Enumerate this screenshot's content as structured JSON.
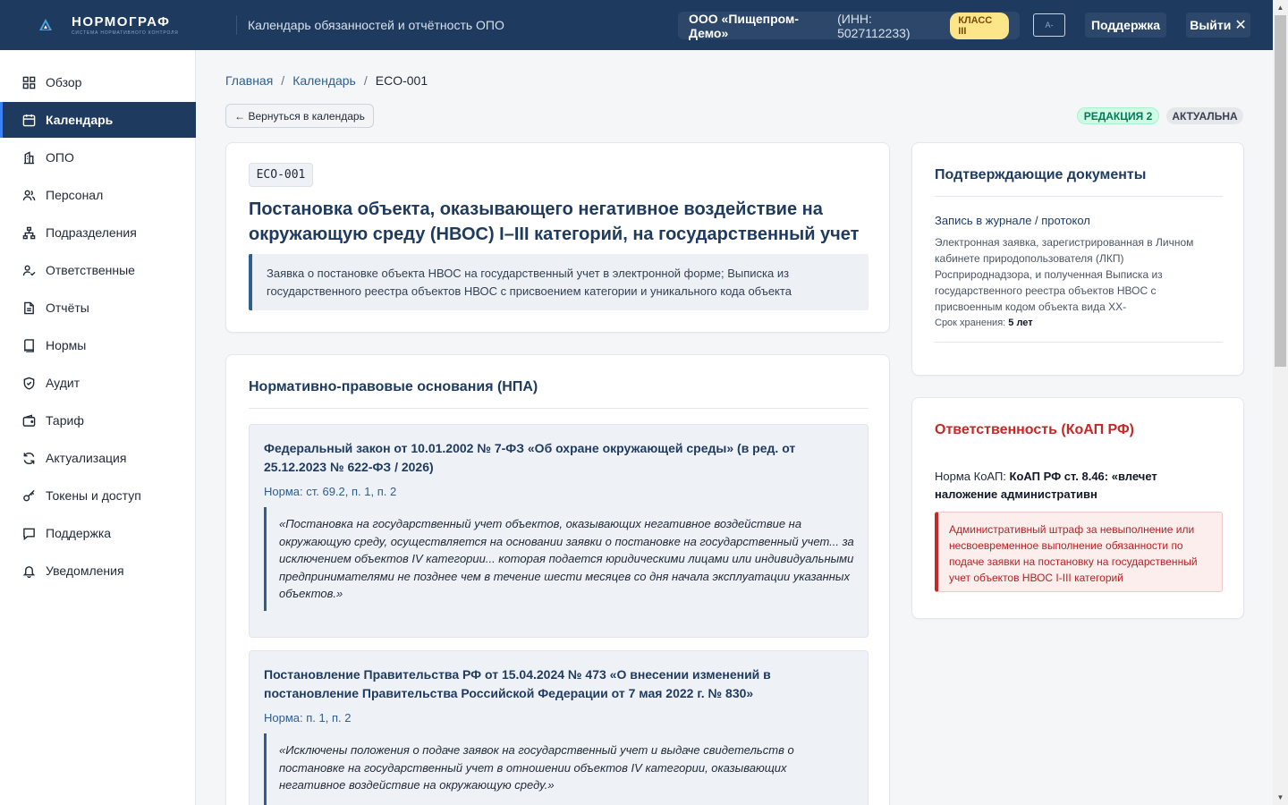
{
  "header": {
    "logo_title": "НОРМОГРАФ",
    "logo_subtitle": "система нормативного контроля",
    "page_title": "Календарь обязанностей и отчётность ОПО",
    "org_name": "ООО «Пищепром-Демо»",
    "org_inn": "(ИНН: 5027112233)",
    "org_class": "КЛАСС III",
    "a11y_label": "A-",
    "support_label": "Поддержка",
    "logout_label": "Выйти",
    "accent": "#1e3a5f"
  },
  "sidebar": {
    "items": [
      {
        "label": "Обзор",
        "icon": "grid-icon"
      },
      {
        "label": "Календарь",
        "icon": "calendar-icon",
        "active": true
      },
      {
        "label": "ОПО",
        "icon": "building-icon"
      },
      {
        "label": "Персонал",
        "icon": "users-icon"
      },
      {
        "label": "Подразделения",
        "icon": "hierarchy-icon"
      },
      {
        "label": "Ответственные",
        "icon": "user-check-icon"
      },
      {
        "label": "Отчёты",
        "icon": "file-icon"
      },
      {
        "label": "Нормы",
        "icon": "book-icon"
      },
      {
        "label": "Аудит",
        "icon": "shield-icon"
      },
      {
        "label": "Тариф",
        "icon": "wallet-icon"
      },
      {
        "label": "Актуализация",
        "icon": "refresh-icon"
      },
      {
        "label": "Токены и доступ",
        "icon": "key-icon"
      },
      {
        "label": "Поддержка",
        "icon": "message-icon"
      },
      {
        "label": "Уведомления",
        "icon": "bell-icon"
      }
    ]
  },
  "breadcrumb": {
    "home": "Главная",
    "calendar": "Календарь",
    "current": "ECO-001",
    "separator": "/"
  },
  "toolbar": {
    "back_label": "← Вернуться в календарь",
    "revision_badge": "РЕДАКЦИЯ 2",
    "status_badge": "АКТУАЛЬНА"
  },
  "obligation": {
    "code": "ECO-001",
    "title": "Постановка объекта, оказывающего негативное воздействие на окружающую среду (НВОС) I–III категорий, на государственный учет",
    "description": "Заявка о постановке объекта НВОС на государственный учет в электронной форме; Выписка из государственного реестра объектов НВОС с присвоением категории и уникального кода объекта"
  },
  "npa": {
    "title": "Нормативно-правовые основания (НПА)",
    "laws": [
      {
        "name": "Федеральный закон от 10.01.2002 № 7-ФЗ «Об охране окружающей среды» (в ред. от 25.12.2023 № 622-ФЗ / 2026)",
        "norm": "Норма: ст. 69.2, п. 1, п. 2",
        "quote": "«Постановка на государственный учет объектов, оказывающих негативное воздействие на окружающую среду, осуществляется на основании заявки о постановке на государственный учет... за исключением объектов IV категории... которая подается юридическими лицами или индивидуальными предпринимателями не позднее чем в течение шести месяцев со дня начала эксплуатации указанных объектов.»"
      },
      {
        "name": "Постановление Правительства РФ от 15.04.2024 № 473 «О внесении изменений в постановление Правительства Российской Федерации от 7 мая 2022 г. № 830»",
        "norm": "Норма: п. 1, п. 2",
        "quote": "«Исключены положения о подаче заявок на государственный учет и выдаче свидетельств о постановке на государственный учет в отношении объектов IV категории, оказывающих негативное воздействие на окружающую среду.»"
      }
    ]
  },
  "documents": {
    "title": "Подтверждающие документы",
    "items": [
      {
        "name": "Запись в журнале / протокол",
        "description": "Электронная заявка, зарегистрированная в Личном кабинете природопользователя (ЛКП) Росприроднадзора, и полученная Выписка из государственного реестра объектов НВОС с присвоенным кодом объекта вида XX-",
        "retention_label": "Срок хранения:",
        "retention_value": "5 лет"
      }
    ]
  },
  "responsibility": {
    "title": "Ответственность (КоАП РФ)",
    "norm_label": "Норма КоАП:",
    "norm_value": "КоАП РФ ст. 8.46: «влечет наложение административн",
    "penalty": "Административный штраф за невыполнение или несвоевременное выполнение обязанности по подаче заявки на постановку на государственный учет объектов НВОС I-III категорий",
    "color": "#c62828"
  }
}
